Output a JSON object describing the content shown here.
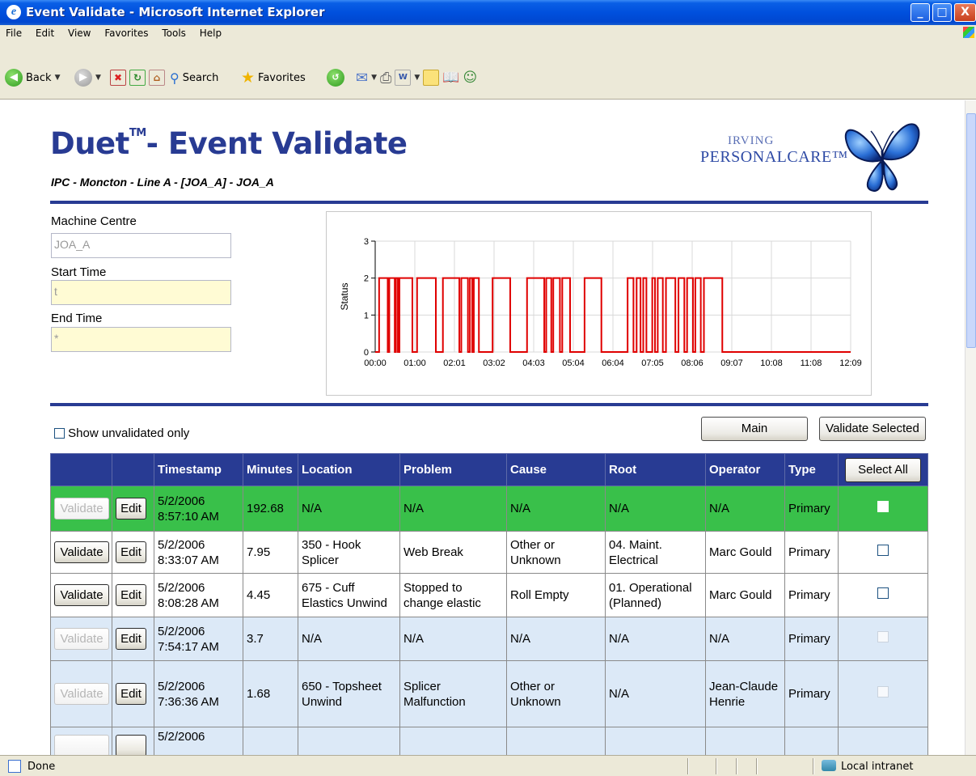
{
  "window": {
    "title": "Event Validate - Microsoft Internet Explorer",
    "minimize": "_",
    "maximize": "□",
    "close": "X"
  },
  "menu": [
    "File",
    "Edit",
    "View",
    "Favorites",
    "Tools",
    "Help"
  ],
  "toolbar": {
    "back": "Back",
    "search": "Search",
    "favorites": "Favorites"
  },
  "page": {
    "title": "Duet",
    "title_tm": "TM",
    "title_rest": "- Event Validate",
    "subtitle": "IPC - Moncton - Line A - [JOA_A] - JOA_A",
    "logo_top": "IRVING",
    "logo_main": "PERSONALCARE™"
  },
  "form": {
    "machine_centre_label": "Machine Centre",
    "machine_centre_value": "JOA_A",
    "start_time_label": "Start Time",
    "start_time_value": "t",
    "end_time_label": "End Time",
    "end_time_value": "*"
  },
  "chart_data": {
    "type": "line",
    "ylabel": "Status",
    "xlabel": "",
    "ylim": [
      0,
      3
    ],
    "yticks": [
      "0",
      "1",
      "2",
      "3"
    ],
    "xticks": [
      "00:00",
      "01:00",
      "02:01",
      "03:02",
      "04:03",
      "05:04",
      "06:04",
      "07:05",
      "08:06",
      "09:07",
      "10:08",
      "11:08",
      "12:09"
    ],
    "xlim_hours": [
      0,
      12.15
    ],
    "color": "#e00000",
    "series": [
      {
        "steps": [
          [
            0.0,
            0
          ],
          [
            0.1,
            2
          ],
          [
            0.32,
            0
          ],
          [
            0.36,
            2
          ],
          [
            0.5,
            0
          ],
          [
            0.53,
            2
          ],
          [
            0.58,
            0
          ],
          [
            0.62,
            2
          ],
          [
            0.95,
            0
          ],
          [
            1.07,
            2
          ],
          [
            1.55,
            0
          ],
          [
            1.73,
            2
          ],
          [
            2.15,
            0
          ],
          [
            2.2,
            2
          ],
          [
            2.37,
            0
          ],
          [
            2.42,
            2
          ],
          [
            2.48,
            0
          ],
          [
            2.52,
            2
          ],
          [
            2.65,
            0
          ],
          [
            3.0,
            2
          ],
          [
            3.45,
            0
          ],
          [
            3.88,
            2
          ],
          [
            4.32,
            0
          ],
          [
            4.37,
            2
          ],
          [
            4.5,
            0
          ],
          [
            4.55,
            2
          ],
          [
            4.72,
            0
          ],
          [
            4.78,
            2
          ],
          [
            4.98,
            0
          ],
          [
            5.35,
            2
          ],
          [
            5.78,
            0
          ],
          [
            6.45,
            2
          ],
          [
            6.6,
            0
          ],
          [
            6.68,
            2
          ],
          [
            6.78,
            0
          ],
          [
            6.85,
            2
          ],
          [
            6.93,
            0
          ],
          [
            7.08,
            2
          ],
          [
            7.15,
            0
          ],
          [
            7.22,
            2
          ],
          [
            7.35,
            0
          ],
          [
            7.43,
            2
          ],
          [
            7.67,
            0
          ],
          [
            7.75,
            2
          ],
          [
            7.9,
            0
          ],
          [
            7.97,
            2
          ],
          [
            8.12,
            0
          ],
          [
            8.18,
            2
          ],
          [
            8.32,
            0
          ],
          [
            8.4,
            2
          ],
          [
            8.87,
            0
          ],
          [
            12.15,
            0
          ]
        ]
      }
    ]
  },
  "controls": {
    "show_unvalidated": "Show unvalidated only",
    "main": "Main",
    "validate_selected": "Validate Selected",
    "select_all": "Select All"
  },
  "table": {
    "headers": [
      "",
      "",
      "Timestamp",
      "Minutes",
      "Location",
      "Problem",
      "Cause",
      "Root",
      "Operator",
      "Type"
    ],
    "rows": [
      {
        "validate": "Validate",
        "edit": "Edit",
        "timestamp_date": "5/2/2006",
        "timestamp_time": "8:57:10 AM",
        "minutes": "192.68",
        "location": "N/A",
        "problem": "N/A",
        "cause": "N/A",
        "root": "N/A",
        "operator": "N/A",
        "type": "Primary"
      },
      {
        "validate": "Validate",
        "edit": "Edit",
        "timestamp_date": "5/2/2006",
        "timestamp_time": "8:33:07 AM",
        "minutes": "7.95",
        "location": "350 - Hook Splicer",
        "problem": "Web Break",
        "cause": "Other or Unknown",
        "root": "04. Maint. Electrical",
        "operator": "Marc Gould",
        "type": "Primary"
      },
      {
        "validate": "Validate",
        "edit": "Edit",
        "timestamp_date": "5/2/2006",
        "timestamp_time": "8:08:28 AM",
        "minutes": "4.45",
        "location": "675 - Cuff Elastics Unwind",
        "problem": "Stopped to change elastic",
        "cause": "Roll Empty",
        "root": "01. Operational (Planned)",
        "operator": "Marc Gould",
        "type": "Primary"
      },
      {
        "validate": "Validate",
        "edit": "Edit",
        "timestamp_date": "5/2/2006",
        "timestamp_time": "7:54:17 AM",
        "minutes": "3.7",
        "location": "N/A",
        "problem": "N/A",
        "cause": "N/A",
        "root": "N/A",
        "operator": "N/A",
        "type": "Primary"
      },
      {
        "validate": "Validate",
        "edit": "Edit",
        "timestamp_date": "5/2/2006",
        "timestamp_time": "7:36:36 AM",
        "minutes": "1.68",
        "location": "650 - Topsheet Unwind",
        "problem": "Splicer Malfunction",
        "cause": "Other or Unknown",
        "root": "N/A",
        "operator": "Jean-Claude Henrie",
        "type": "Primary"
      },
      {
        "validate": "",
        "edit": "",
        "timestamp_date": "5/2/2006",
        "timestamp_time": "",
        "minutes": "",
        "location": "",
        "problem": "",
        "cause": "",
        "root": "",
        "operator": "",
        "type": ""
      }
    ]
  },
  "status": {
    "left": "Done",
    "zone": "Local intranet"
  }
}
